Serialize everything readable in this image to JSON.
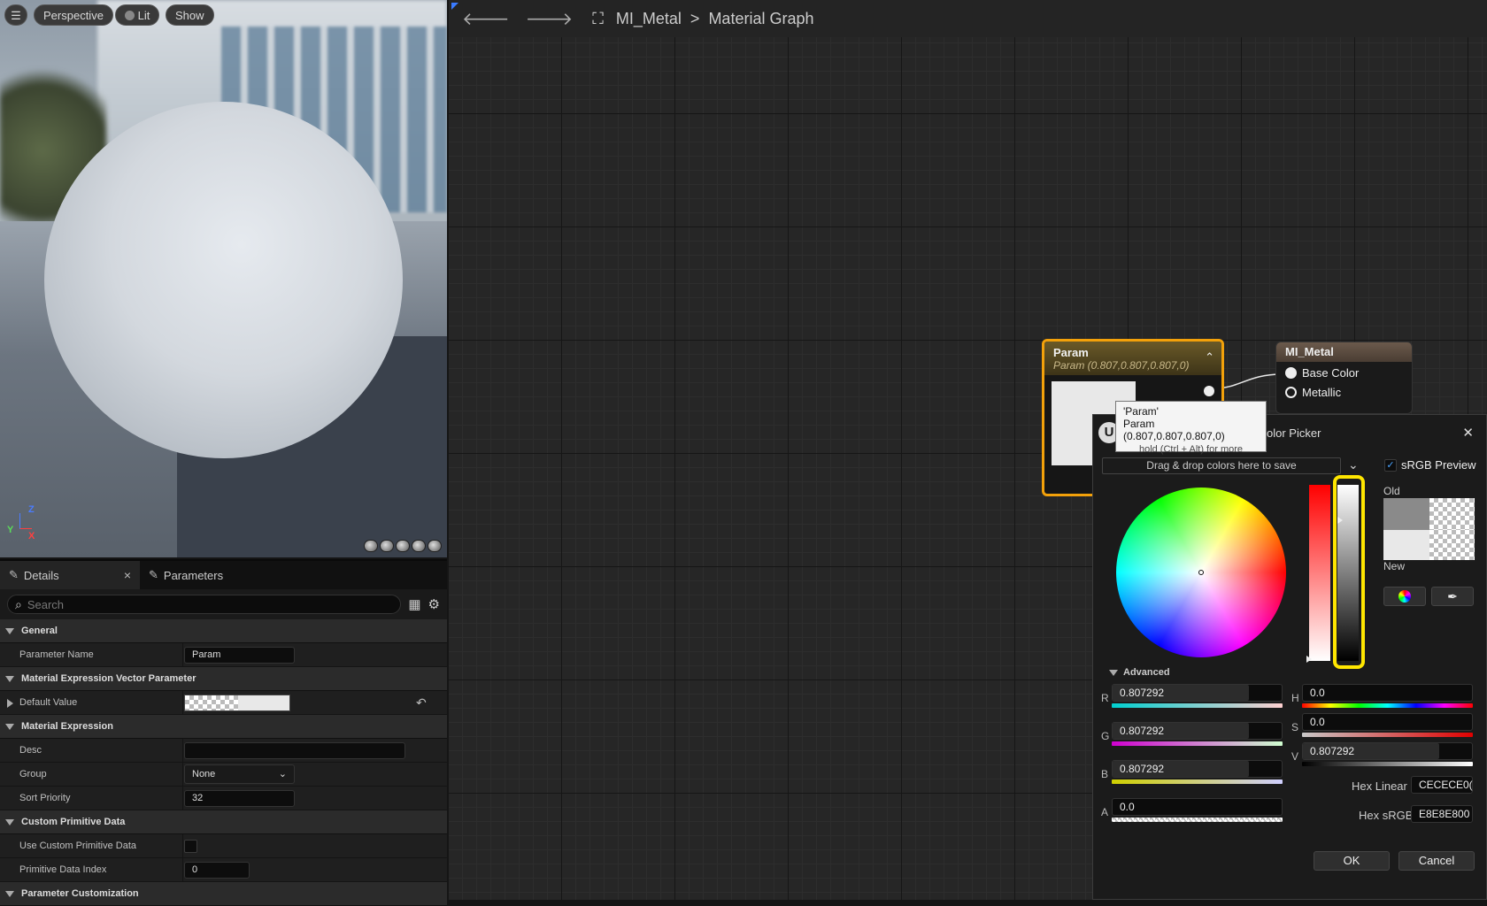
{
  "viewport": {
    "buttons": {
      "perspective": "Perspective",
      "lit": "Lit",
      "show": "Show"
    },
    "axes": {
      "z": "Z",
      "x": "X",
      "y": "Y"
    }
  },
  "details": {
    "tabs": [
      {
        "label": "Details",
        "close": "×"
      },
      {
        "label": "Parameters"
      }
    ],
    "search_placeholder": "Search",
    "general": {
      "title": "General",
      "parameter_name_label": "Parameter Name",
      "parameter_name_value": "Param"
    },
    "vector_param": {
      "title": "Material Expression Vector Parameter",
      "default_value_label": "Default Value"
    },
    "material_expression": {
      "title": "Material Expression",
      "desc_label": "Desc",
      "desc_value": "",
      "group_label": "Group",
      "group_value": "None",
      "sort_priority_label": "Sort Priority",
      "sort_priority_value": "32"
    },
    "custom_primitive": {
      "title": "Custom Primitive Data",
      "use_label": "Use Custom Primitive Data",
      "index_label": "Primitive Data Index",
      "index_value": "0"
    },
    "param_customization": {
      "title": "Parameter Customization"
    }
  },
  "graph": {
    "breadcrumb": {
      "asset": "MI_Metal",
      "separator": ">",
      "graph": "Material Graph"
    },
    "param_node": {
      "title": "Param",
      "subtitle": "Param (0.807,0.807,0.807,0)"
    },
    "metal_node": {
      "title": "MI_Metal",
      "pins": [
        "Base Color",
        "Metallic"
      ]
    }
  },
  "tooltip": {
    "name": "'Param'",
    "value": "Param (0.807,0.807,0.807,0)",
    "hint": "hold (Ctrl + Alt) for more"
  },
  "color_picker": {
    "title": "olor Picker",
    "close": "✕",
    "drop_area": "Drag & drop colors here to save",
    "srgb_preview": "sRGB Preview",
    "srgb_checked": true,
    "old_label": "Old",
    "new_label": "New",
    "advanced_label": "Advanced",
    "channels": {
      "r": {
        "label": "R",
        "value": "0.807292",
        "fill": 0.807292
      },
      "g": {
        "label": "G",
        "value": "0.807292",
        "fill": 0.807292
      },
      "b": {
        "label": "B",
        "value": "0.807292",
        "fill": 0.807292
      },
      "a": {
        "label": "A",
        "value": "0.0",
        "fill": 0.0
      },
      "h": {
        "label": "H",
        "value": "0.0",
        "fill": 0.0
      },
      "s": {
        "label": "S",
        "value": "0.0",
        "fill": 0.0
      },
      "v": {
        "label": "V",
        "value": "0.807292",
        "fill": 0.807292
      }
    },
    "hex_linear_label": "Hex Linear",
    "hex_linear_value": "CECECE0(",
    "hex_srgb_label": "Hex sRGB",
    "hex_srgb_value": "E8E8E800",
    "ok_label": "OK",
    "cancel_label": "Cancel"
  },
  "colors": {
    "accent_orange": "#f3a10a",
    "highlight_yellow": "#ffe600",
    "old_color": "#8a8a8a",
    "new_color": "#e8e8e8"
  }
}
